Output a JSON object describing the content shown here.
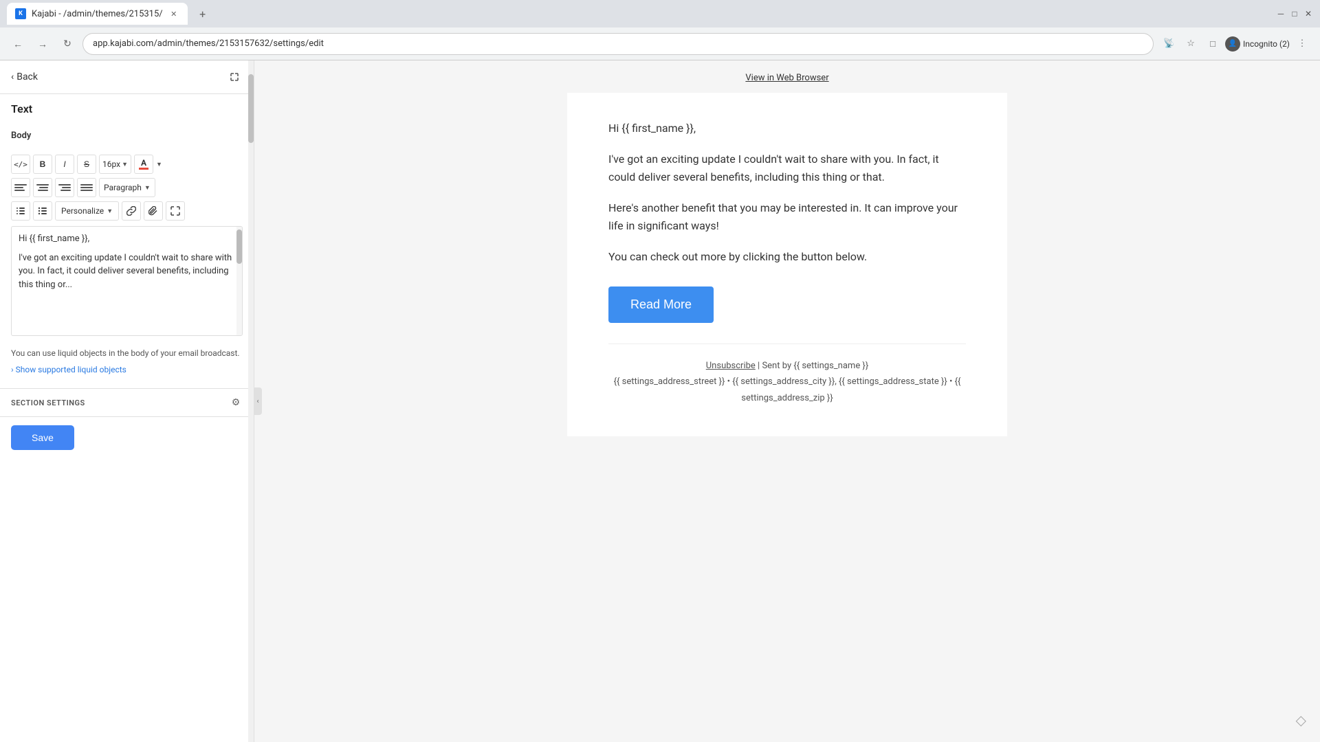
{
  "browser": {
    "tab_title": "Kajabi - /admin/themes/215315/",
    "tab_favicon": "K",
    "address_bar": "app.kajabi.com/admin/themes/2153157632/settings/edit",
    "incognito_label": "Incognito (2)"
  },
  "panel": {
    "back_label": "Back",
    "title": "Text",
    "section_label": "Body",
    "font_size": "16px",
    "paragraph_option": "Paragraph",
    "personalize_label": "Personalize",
    "editor_content_line1": "Hi {{ first_name }},",
    "editor_content_line2": "I've got an exciting update I couldn't wait to share with you. In fact, it could deliver several benefits, including this thing or...",
    "liquid_hint": "You can use liquid objects in the body of your email broadcast.",
    "show_liquid_label": "Show supported liquid objects",
    "section_settings_label": "SECTION SETTINGS",
    "save_label": "Save"
  },
  "preview": {
    "view_in_browser": "View in Web Browser",
    "greeting": "Hi {{ first_name }},",
    "paragraph1": "I've got an exciting update I couldn't wait to share with you. In fact, it could deliver several benefits, including this thing or that.",
    "paragraph2": "Here's another benefit that you may be interested in. It can improve your life in significant ways!",
    "paragraph3": "You can check out more by clicking the button below.",
    "read_more_label": "Read More",
    "footer_unsubscribe": "Unsubscribe",
    "footer_sent_by": "| Sent by {{ settings_name }}",
    "footer_address": "{{ settings_address_street }} • {{ settings_address_city }}, {{ settings_address_state }} • {{ settings_address_zip }}"
  }
}
